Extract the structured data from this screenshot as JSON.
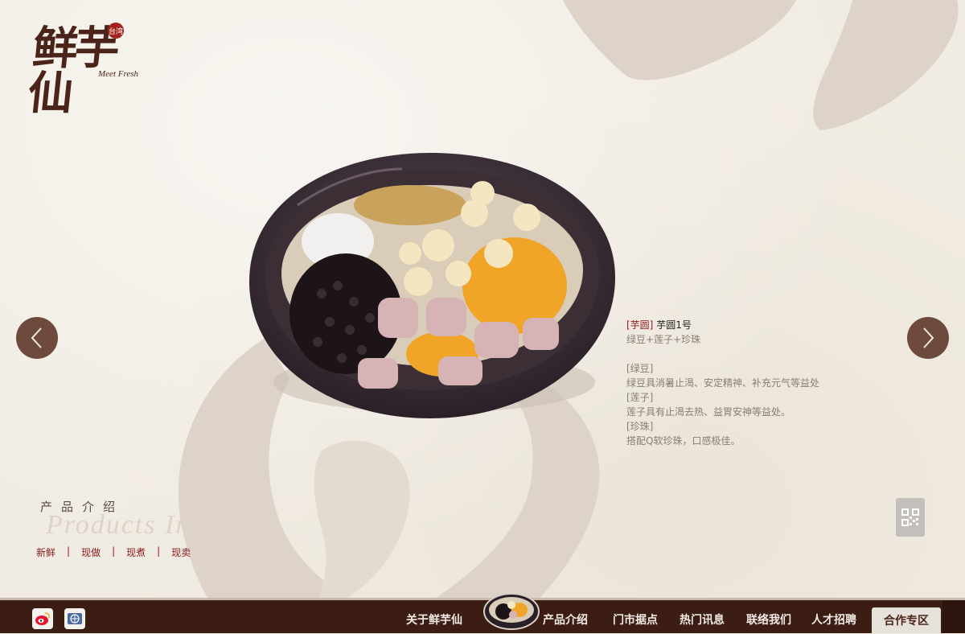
{
  "brand": {
    "name_cn": "鲜芋仙",
    "name_en": "Meet Fresh",
    "seal_text": "台湾"
  },
  "product": {
    "category_tag": "[芋圆]",
    "name": "芋圆1号",
    "composition": "绿豆+莲子+珍珠",
    "ingredients": [
      {
        "heading": "[绿豆]",
        "desc": "绿豆具消暑止渴、安定精神、补充元气等益处"
      },
      {
        "heading": "[莲子]",
        "desc": "莲子具有止渴去热、益胃安神等益处。"
      },
      {
        "heading": "[珍珠]",
        "desc": "搭配Q软珍珠，口感极佳。"
      }
    ]
  },
  "section": {
    "title_cn": "产品介绍",
    "title_en": "Products Intro",
    "slogan": [
      "新鲜",
      "现做",
      "现煮",
      "现卖"
    ]
  },
  "nav": {
    "items": [
      "关于鲜芋仙",
      "产品介绍",
      "门市据点",
      "热门讯息",
      "联络我们",
      "人才招聘"
    ],
    "cooperation": "合作专区"
  },
  "colors": {
    "background": "#f1ece3",
    "brush": "#ddd3c8",
    "brand_brown": "#4a2418",
    "accent_red": "#8a1d20",
    "footer": "#3b1d14",
    "arrow": "#6e4a3d"
  },
  "icons": {
    "prev": "chevron-left-icon",
    "next": "chevron-right-icon",
    "qr": "qr-code-icon",
    "weibo": "weibo-icon",
    "website": "globe-icon"
  }
}
